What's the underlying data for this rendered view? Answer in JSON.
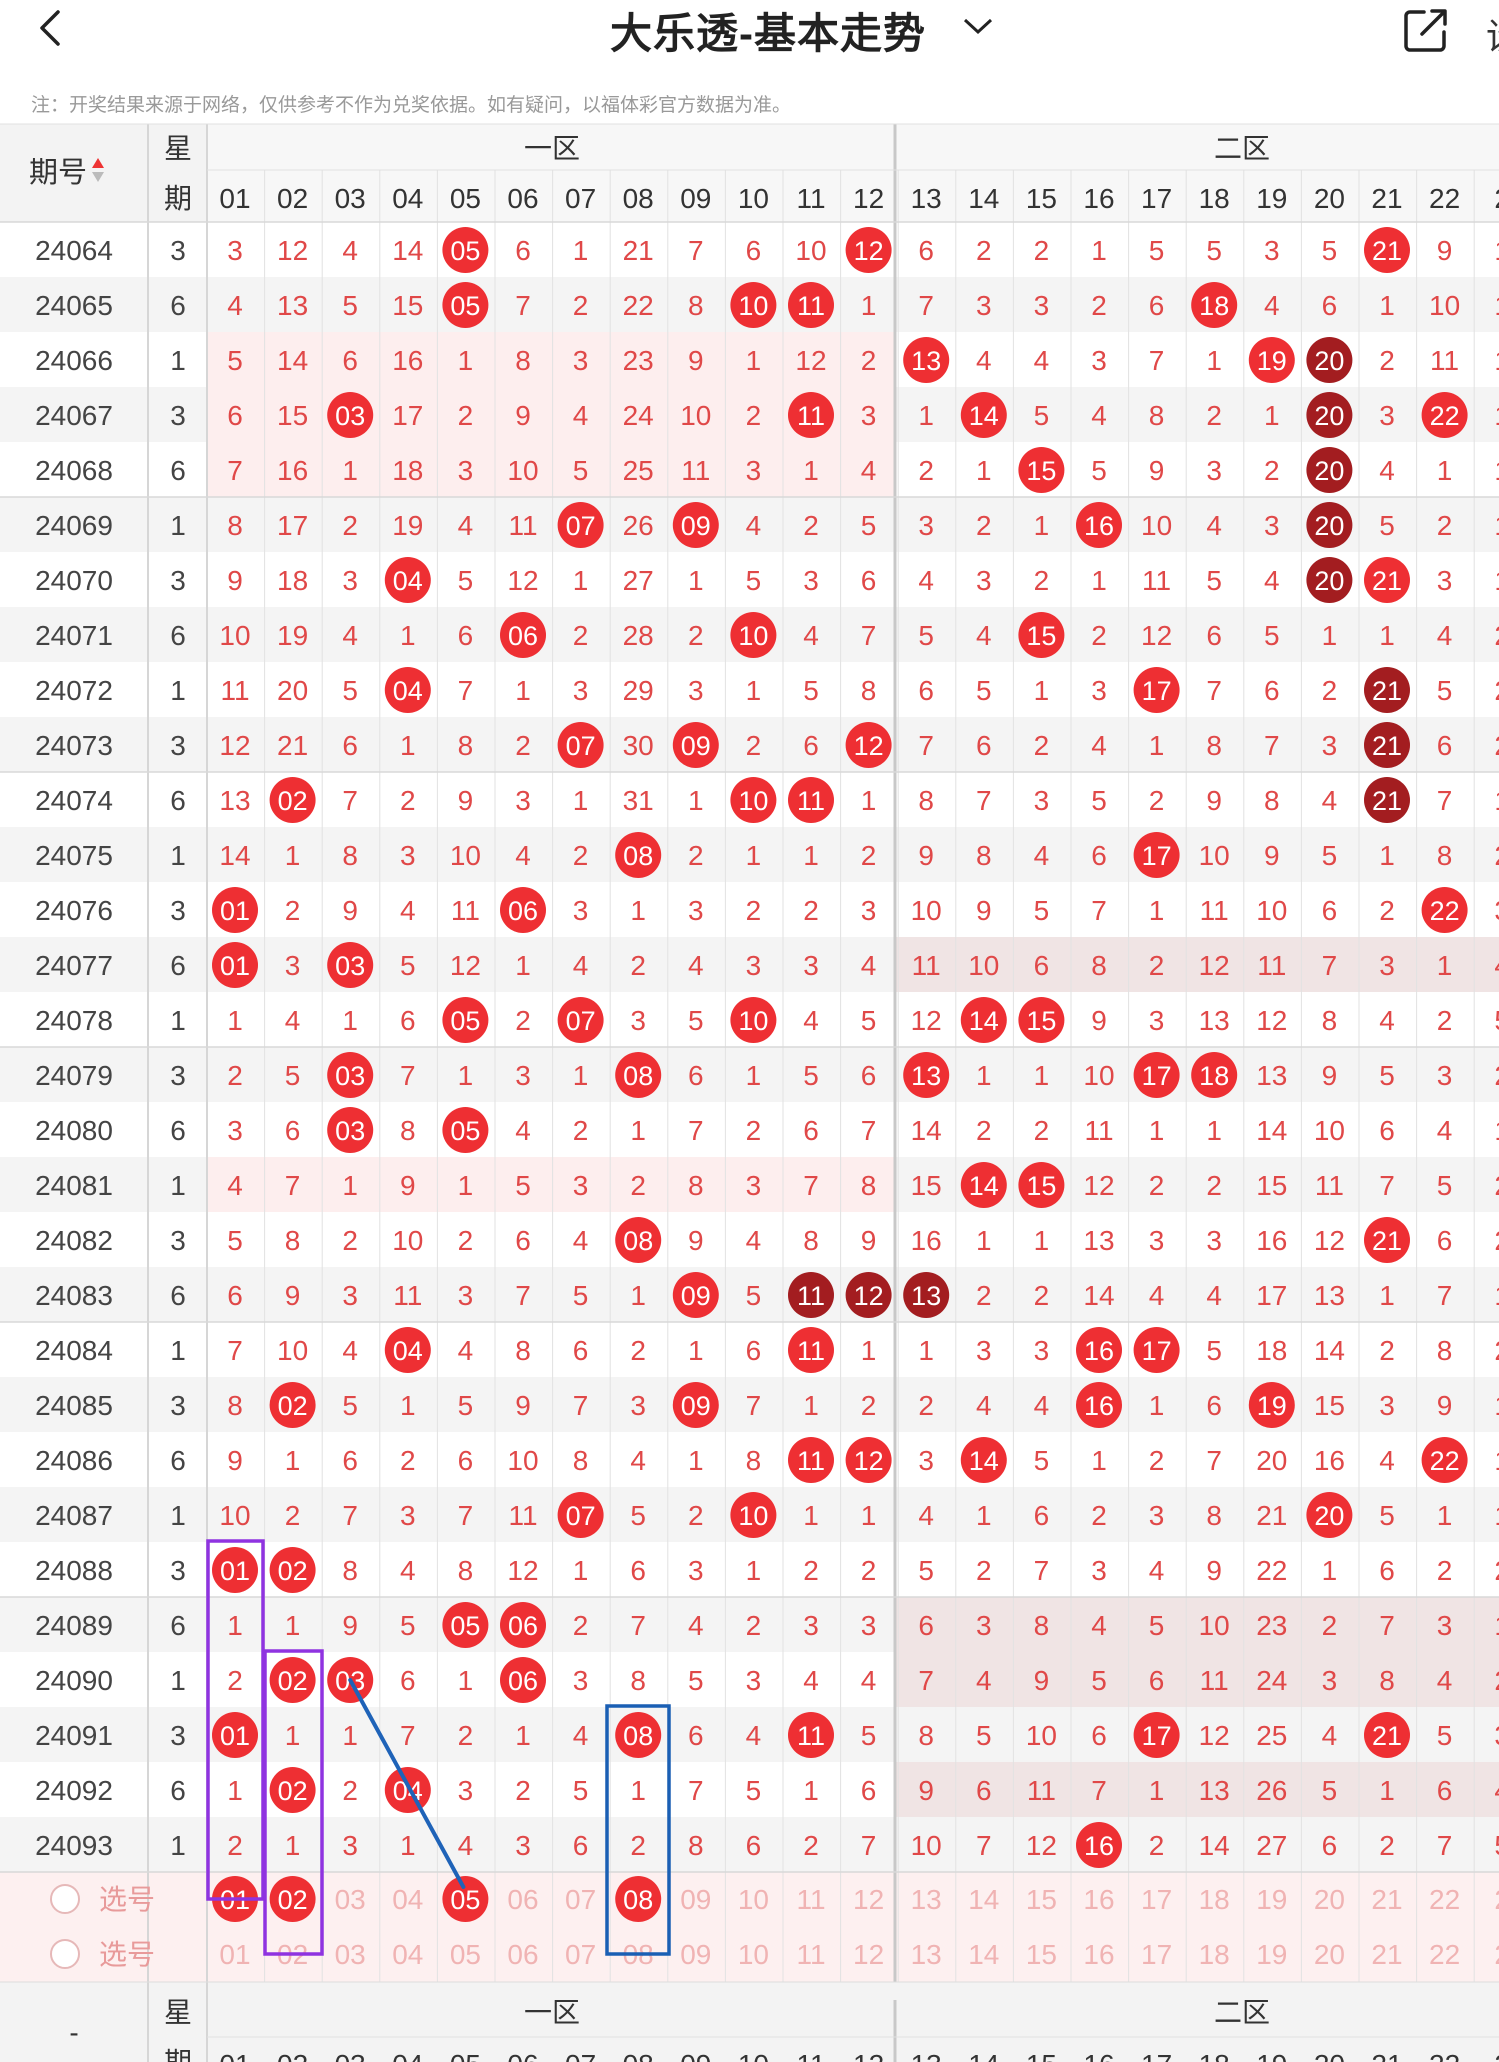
{
  "header": {
    "title": "大乐透-基本走势",
    "right_partial": "设"
  },
  "notice": "注：开奖结果来源于网络，仅供参考不作为兑奖依据。如有疑问，以福体彩官方数据为准。",
  "table": {
    "issue_label": "期号",
    "week_label_1": "星",
    "week_label_2": "期",
    "zone1_label": "一区",
    "zone2_label": "二区",
    "columns": [
      "01",
      "02",
      "03",
      "04",
      "05",
      "06",
      "07",
      "08",
      "09",
      "10",
      "11",
      "12",
      "13",
      "14",
      "15",
      "16",
      "17",
      "18",
      "19",
      "20",
      "21",
      "22",
      "2"
    ],
    "rows": [
      {
        "issue": "24064",
        "week": "3",
        "cells": [
          "3",
          "12",
          "4",
          "14",
          "05",
          "6",
          "1",
          "21",
          "7",
          "6",
          "10",
          "12",
          "6",
          "2",
          "2",
          "1",
          "5",
          "5",
          "3",
          "5",
          "21",
          "9",
          "1"
        ]
      },
      {
        "issue": "24065",
        "week": "6",
        "cells": [
          "4",
          "13",
          "5",
          "15",
          "05",
          "7",
          "2",
          "22",
          "8",
          "10",
          "11",
          "1",
          "7",
          "3",
          "3",
          "2",
          "6",
          "18",
          "4",
          "6",
          "1",
          "10",
          "1"
        ]
      },
      {
        "issue": "24066",
        "week": "1",
        "cells": [
          "5",
          "14",
          "6",
          "16",
          "1",
          "8",
          "3",
          "23",
          "9",
          "1",
          "12",
          "2",
          "13",
          "4",
          "4",
          "3",
          "7",
          "1",
          "19",
          "20",
          "2",
          "11",
          "1"
        ]
      },
      {
        "issue": "24067",
        "week": "3",
        "cells": [
          "6",
          "15",
          "03",
          "17",
          "2",
          "9",
          "4",
          "24",
          "10",
          "2",
          "11",
          "3",
          "1",
          "14",
          "5",
          "4",
          "8",
          "2",
          "1",
          "20",
          "3",
          "22",
          "1"
        ]
      },
      {
        "issue": "24068",
        "week": "6",
        "cells": [
          "7",
          "16",
          "1",
          "18",
          "3",
          "10",
          "5",
          "25",
          "11",
          "3",
          "1",
          "4",
          "2",
          "1",
          "15",
          "5",
          "9",
          "3",
          "2",
          "20",
          "4",
          "1",
          "1"
        ]
      },
      {
        "issue": "24069",
        "week": "1",
        "cells": [
          "8",
          "17",
          "2",
          "19",
          "4",
          "11",
          "07",
          "26",
          "09",
          "4",
          "2",
          "5",
          "3",
          "2",
          "1",
          "16",
          "10",
          "4",
          "3",
          "20",
          "5",
          "2",
          "1"
        ]
      },
      {
        "issue": "24070",
        "week": "3",
        "cells": [
          "9",
          "18",
          "3",
          "04",
          "5",
          "12",
          "1",
          "27",
          "1",
          "5",
          "3",
          "6",
          "4",
          "3",
          "2",
          "1",
          "11",
          "5",
          "4",
          "20",
          "21",
          "3",
          "1"
        ]
      },
      {
        "issue": "24071",
        "week": "6",
        "cells": [
          "10",
          "19",
          "4",
          "1",
          "6",
          "06",
          "2",
          "28",
          "2",
          "10",
          "4",
          "7",
          "5",
          "4",
          "15",
          "2",
          "12",
          "6",
          "5",
          "1",
          "1",
          "4",
          "2"
        ]
      },
      {
        "issue": "24072",
        "week": "1",
        "cells": [
          "11",
          "20",
          "5",
          "04",
          "7",
          "1",
          "3",
          "29",
          "3",
          "1",
          "5",
          "8",
          "6",
          "5",
          "1",
          "3",
          "17",
          "7",
          "6",
          "2",
          "21",
          "5",
          "2"
        ]
      },
      {
        "issue": "24073",
        "week": "3",
        "cells": [
          "12",
          "21",
          "6",
          "1",
          "8",
          "2",
          "07",
          "30",
          "09",
          "2",
          "6",
          "12",
          "7",
          "6",
          "2",
          "4",
          "1",
          "8",
          "7",
          "3",
          "21",
          "6",
          "2"
        ]
      },
      {
        "issue": "24074",
        "week": "6",
        "cells": [
          "13",
          "02",
          "7",
          "2",
          "9",
          "3",
          "1",
          "31",
          "1",
          "10",
          "11",
          "1",
          "8",
          "7",
          "3",
          "5",
          "2",
          "9",
          "8",
          "4",
          "21",
          "7",
          "1"
        ]
      },
      {
        "issue": "24075",
        "week": "1",
        "cells": [
          "14",
          "1",
          "8",
          "3",
          "10",
          "4",
          "2",
          "08",
          "2",
          "1",
          "1",
          "2",
          "9",
          "8",
          "4",
          "6",
          "17",
          "10",
          "9",
          "5",
          "1",
          "8",
          "2"
        ]
      },
      {
        "issue": "24076",
        "week": "3",
        "cells": [
          "01",
          "2",
          "9",
          "4",
          "11",
          "06",
          "3",
          "1",
          "3",
          "2",
          "2",
          "3",
          "10",
          "9",
          "5",
          "7",
          "1",
          "11",
          "10",
          "6",
          "2",
          "22",
          "3"
        ]
      },
      {
        "issue": "24077",
        "week": "6",
        "cells": [
          "01",
          "3",
          "03",
          "5",
          "12",
          "1",
          "4",
          "2",
          "4",
          "3",
          "3",
          "4",
          "11",
          "10",
          "6",
          "8",
          "2",
          "12",
          "11",
          "7",
          "3",
          "1",
          "4"
        ]
      },
      {
        "issue": "24078",
        "week": "1",
        "cells": [
          "1",
          "4",
          "1",
          "6",
          "05",
          "2",
          "07",
          "3",
          "5",
          "10",
          "4",
          "5",
          "12",
          "14",
          "15",
          "9",
          "3",
          "13",
          "12",
          "8",
          "4",
          "2",
          "5"
        ]
      },
      {
        "issue": "24079",
        "week": "3",
        "cells": [
          "2",
          "5",
          "03",
          "7",
          "1",
          "3",
          "1",
          "08",
          "6",
          "1",
          "5",
          "6",
          "13",
          "1",
          "1",
          "10",
          "17",
          "18",
          "13",
          "9",
          "5",
          "3",
          "2"
        ]
      },
      {
        "issue": "24080",
        "week": "6",
        "cells": [
          "3",
          "6",
          "03",
          "8",
          "05",
          "4",
          "2",
          "1",
          "7",
          "2",
          "6",
          "7",
          "14",
          "2",
          "2",
          "11",
          "1",
          "1",
          "14",
          "10",
          "6",
          "4",
          "1"
        ]
      },
      {
        "issue": "24081",
        "week": "1",
        "cells": [
          "4",
          "7",
          "1",
          "9",
          "1",
          "5",
          "3",
          "2",
          "8",
          "3",
          "7",
          "8",
          "15",
          "14",
          "15",
          "12",
          "2",
          "2",
          "15",
          "11",
          "7",
          "5",
          "2"
        ]
      },
      {
        "issue": "24082",
        "week": "3",
        "cells": [
          "5",
          "8",
          "2",
          "10",
          "2",
          "6",
          "4",
          "08",
          "9",
          "4",
          "8",
          "9",
          "16",
          "1",
          "1",
          "13",
          "3",
          "3",
          "16",
          "12",
          "21",
          "6",
          "2"
        ]
      },
      {
        "issue": "24083",
        "week": "6",
        "cells": [
          "6",
          "9",
          "3",
          "11",
          "3",
          "7",
          "5",
          "1",
          "09",
          "5",
          "11",
          "12",
          "13",
          "2",
          "2",
          "14",
          "4",
          "4",
          "17",
          "13",
          "1",
          "7",
          "1"
        ]
      },
      {
        "issue": "24084",
        "week": "1",
        "cells": [
          "7",
          "10",
          "4",
          "04",
          "4",
          "8",
          "6",
          "2",
          "1",
          "6",
          "11",
          "1",
          "1",
          "3",
          "3",
          "16",
          "17",
          "5",
          "18",
          "14",
          "2",
          "8",
          "2"
        ]
      },
      {
        "issue": "24085",
        "week": "3",
        "cells": [
          "8",
          "02",
          "5",
          "1",
          "5",
          "9",
          "7",
          "3",
          "09",
          "7",
          "1",
          "2",
          "2",
          "4",
          "4",
          "16",
          "1",
          "6",
          "19",
          "15",
          "3",
          "9",
          "1"
        ]
      },
      {
        "issue": "24086",
        "week": "6",
        "cells": [
          "9",
          "1",
          "6",
          "2",
          "6",
          "10",
          "8",
          "4",
          "1",
          "8",
          "11",
          "12",
          "3",
          "14",
          "5",
          "1",
          "2",
          "7",
          "20",
          "16",
          "4",
          "22",
          "1"
        ]
      },
      {
        "issue": "24087",
        "week": "1",
        "cells": [
          "10",
          "2",
          "7",
          "3",
          "7",
          "11",
          "07",
          "5",
          "2",
          "10",
          "1",
          "1",
          "4",
          "1",
          "6",
          "2",
          "3",
          "8",
          "21",
          "20",
          "5",
          "1",
          "1"
        ]
      },
      {
        "issue": "24088",
        "week": "3",
        "cells": [
          "01",
          "02",
          "8",
          "4",
          "8",
          "12",
          "1",
          "6",
          "3",
          "1",
          "2",
          "2",
          "5",
          "2",
          "7",
          "3",
          "4",
          "9",
          "22",
          "1",
          "6",
          "2",
          "2"
        ]
      },
      {
        "issue": "24089",
        "week": "6",
        "cells": [
          "1",
          "1",
          "9",
          "5",
          "05",
          "06",
          "2",
          "7",
          "4",
          "2",
          "3",
          "3",
          "6",
          "3",
          "8",
          "4",
          "5",
          "10",
          "23",
          "2",
          "7",
          "3",
          "1"
        ]
      },
      {
        "issue": "24090",
        "week": "1",
        "cells": [
          "2",
          "02",
          "03",
          "6",
          "1",
          "06",
          "3",
          "8",
          "5",
          "3",
          "4",
          "4",
          "7",
          "4",
          "9",
          "5",
          "6",
          "11",
          "24",
          "3",
          "8",
          "4",
          "2"
        ]
      },
      {
        "issue": "24091",
        "week": "3",
        "cells": [
          "01",
          "1",
          "1",
          "7",
          "2",
          "1",
          "4",
          "08",
          "6",
          "4",
          "11",
          "5",
          "8",
          "5",
          "10",
          "6",
          "17",
          "12",
          "25",
          "4",
          "21",
          "5",
          "3"
        ]
      },
      {
        "issue": "24092",
        "week": "6",
        "cells": [
          "1",
          "02",
          "2",
          "04",
          "3",
          "2",
          "5",
          "1",
          "7",
          "5",
          "1",
          "6",
          "9",
          "6",
          "11",
          "7",
          "1",
          "13",
          "26",
          "5",
          "1",
          "6",
          "4"
        ]
      },
      {
        "issue": "24093",
        "week": "1",
        "cells": [
          "2",
          "1",
          "3",
          "1",
          "4",
          "3",
          "6",
          "2",
          "8",
          "6",
          "2",
          "7",
          "10",
          "7",
          "12",
          "16",
          "2",
          "14",
          "27",
          "6",
          "2",
          "7",
          "5"
        ]
      }
    ],
    "pick_label": "选号",
    "pick_row_1": [
      "01",
      "02",
      "03",
      "04",
      "05",
      "06",
      "07",
      "08",
      "09",
      "10",
      "11",
      "12",
      "13",
      "14",
      "15",
      "16",
      "17",
      "18",
      "19",
      "20",
      "21",
      "22",
      "2"
    ],
    "pick_row_2": [
      "01",
      "02",
      "03",
      "04",
      "05",
      "06",
      "07",
      "08",
      "09",
      "10",
      "11",
      "12",
      "13",
      "14",
      "15",
      "16",
      "17",
      "18",
      "19",
      "20",
      "21",
      "22",
      "2"
    ],
    "footer_issue": "-",
    "footer_week_1": "星",
    "footer_week_2": "期",
    "footer_columns": [
      "01",
      "02",
      "03",
      "04",
      "05",
      "06",
      "07",
      "08",
      "09",
      "10",
      "11",
      "12",
      "13",
      "14",
      "15",
      "16",
      "17",
      "18",
      "19",
      "20",
      "21",
      "22",
      "2"
    ]
  },
  "colors": {
    "ball": "#ee2f33",
    "ball_dark": "#a31d20",
    "number": "#e04848",
    "accent_purple": "#8f33e0",
    "accent_blue": "#1a5fb4",
    "line_blue": "#1f63b8",
    "stripe": "#f4f4f4",
    "pink": "#fdeeee"
  }
}
